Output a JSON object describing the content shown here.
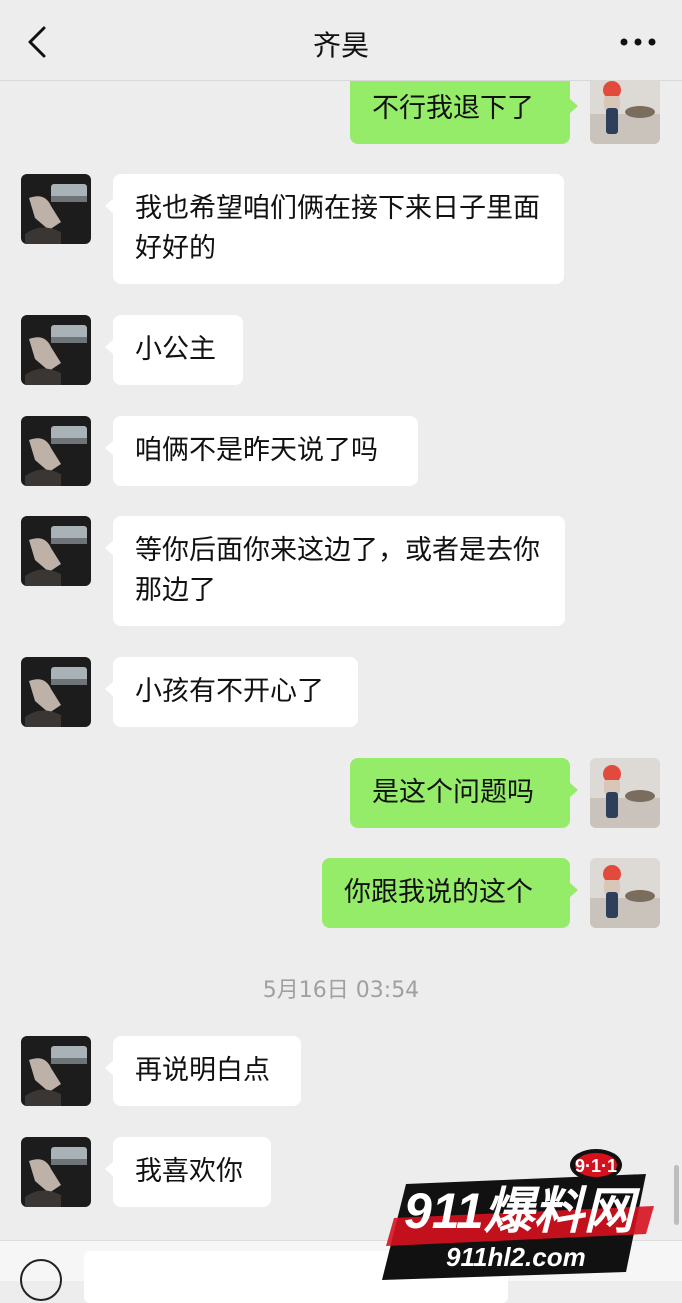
{
  "header": {
    "title": "齐昊",
    "back_icon": "chevron-left-icon",
    "more_icon": "more-dots-icon"
  },
  "messages": [
    {
      "side": "out",
      "text": "不行我退下了"
    },
    {
      "side": "in",
      "text": "我也希望咱们俩在接下来日子里面好好的"
    },
    {
      "side": "in",
      "text": "小公主"
    },
    {
      "side": "in",
      "text": "咱俩不是昨天说了吗"
    },
    {
      "side": "in",
      "text": "等你后面你来这边了，或者是去你那边了"
    },
    {
      "side": "in",
      "text": "小孩有不开心了"
    },
    {
      "side": "out",
      "text": "是这个问题吗"
    },
    {
      "side": "out",
      "text": "你跟我说的这个"
    },
    {
      "side": "in",
      "text": "再说明白点"
    },
    {
      "side": "in",
      "text": "我喜欢你"
    }
  ],
  "timestamp": "5月16日 03:54",
  "watermark": {
    "badge": "9·1·1",
    "brand": "911爆料网",
    "url": "911hl2.com"
  },
  "colors": {
    "background": "#ededed",
    "bubble_in": "#ffffff",
    "bubble_out": "#95ec69",
    "watermark_red": "#d6111e"
  }
}
